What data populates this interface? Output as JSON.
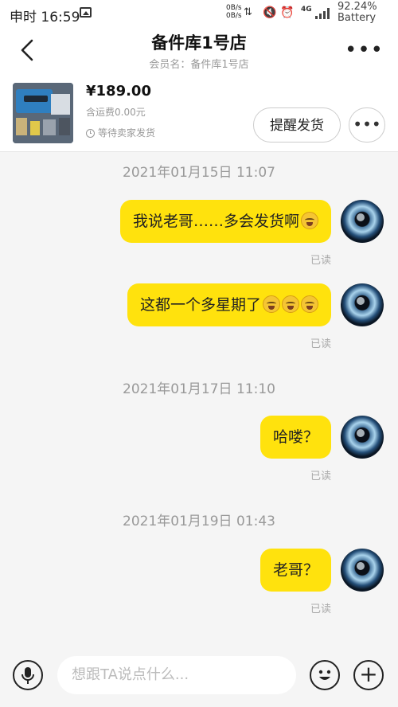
{
  "status_bar": {
    "time": "申时 16:59",
    "rate_up": "0B/s",
    "rate_down": "0B/s",
    "network": "4G",
    "battery_percent": "92.24%",
    "battery_label": "Battery"
  },
  "header": {
    "title": "备件库1号店",
    "subtitle": "会员名：备件库1号店",
    "back_icon": "chevron-left-icon",
    "more_icon": "more-horizontal-icon"
  },
  "product": {
    "price": "¥189.00",
    "shipping_fee": "含运费0.00元",
    "status": "等待卖家发货",
    "remind_button": "提醒发货",
    "more_button": "•••"
  },
  "chat": [
    {
      "timestamp": "2021年01月15日 11:07"
    },
    {
      "text": "我说老哥……多会发货啊",
      "emojis": 1,
      "read": "已读"
    },
    {
      "text": "这都一个多星期了",
      "emojis": 3,
      "read": "已读"
    },
    {
      "timestamp": "2021年01月17日 11:10"
    },
    {
      "text": "哈喽？",
      "emojis": 0,
      "read": "已读"
    },
    {
      "timestamp": "2021年01月19日 01:43"
    },
    {
      "text": "老哥？",
      "emojis": 0,
      "read": "已读"
    }
  ],
  "input_bar": {
    "placeholder": "想跟TA说点什么...",
    "voice_icon": "microphone-icon",
    "emoji_icon": "smiley-icon",
    "plus_icon": "plus-icon"
  },
  "colors": {
    "bubble": "#ffe20d",
    "background": "#f5f5f5",
    "muted_text": "#999999"
  }
}
